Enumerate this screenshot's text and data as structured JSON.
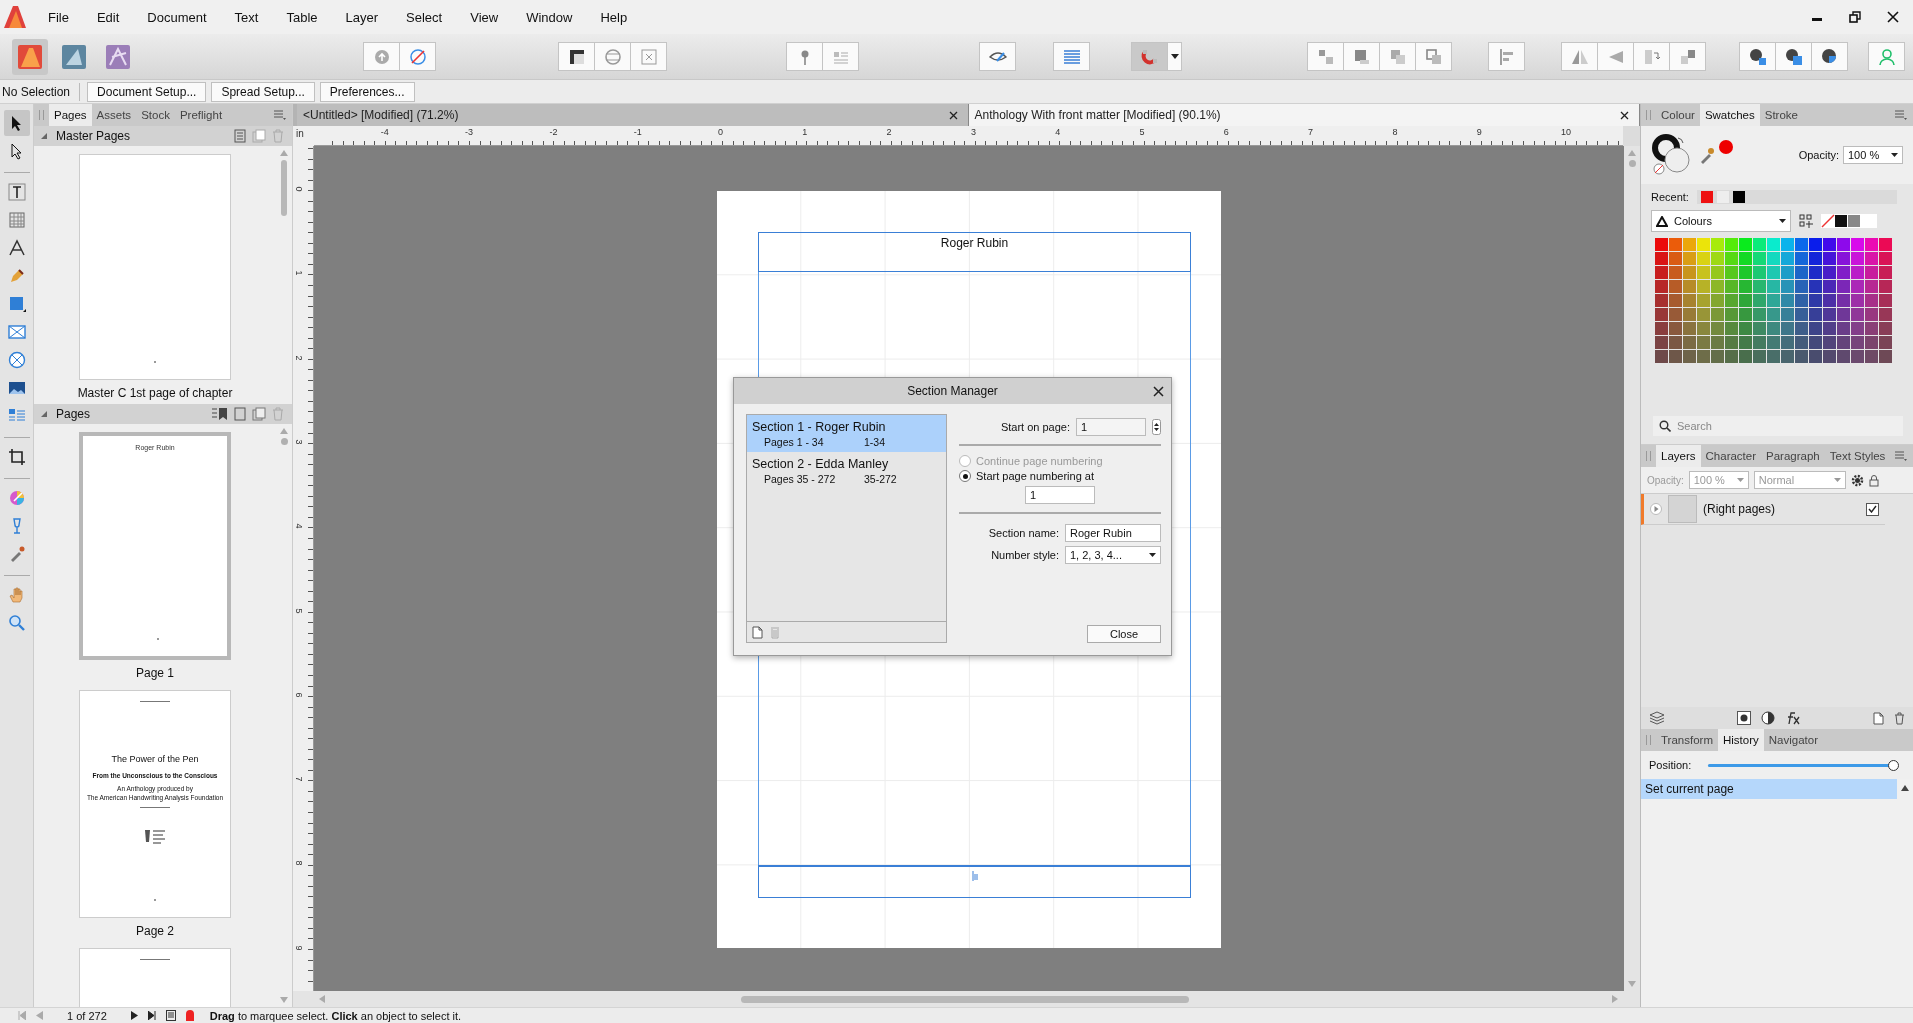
{
  "menu": [
    "File",
    "Edit",
    "Document",
    "Text",
    "Table",
    "Layer",
    "Select",
    "View",
    "Window",
    "Help"
  ],
  "personas": [
    {
      "selected": true
    },
    {
      "selected": false
    },
    {
      "selected": false
    }
  ],
  "snapping": {
    "on": true
  },
  "context_bar": {
    "status": "No Selection",
    "buttons": [
      "Document Setup...",
      "Spread Setup...",
      "Preferences..."
    ]
  },
  "tools": [
    {
      "kind": "move",
      "selected": true
    },
    {
      "kind": "node",
      "selected": false
    },
    {
      "kind": "text",
      "selected": false
    },
    {
      "kind": "table",
      "selected": false
    },
    {
      "kind": "artistic",
      "selected": false
    },
    {
      "kind": "pen",
      "selected": false
    },
    {
      "kind": "rectangle",
      "selected": false
    },
    {
      "kind": "frame",
      "selected": false
    },
    {
      "kind": "ellipse",
      "selected": false
    },
    {
      "kind": "image",
      "selected": false
    },
    {
      "kind": "wrap",
      "selected": false
    },
    {
      "kind": "crop",
      "selected": false
    },
    {
      "kind": "fill",
      "selected": false
    },
    {
      "kind": "transparency",
      "selected": false
    },
    {
      "kind": "picker",
      "selected": false
    },
    {
      "kind": "hand",
      "selected": false
    },
    {
      "kind": "zoom",
      "selected": false
    }
  ],
  "pages_panel": {
    "tabs": [
      {
        "label": "Pages",
        "selected": true
      },
      {
        "label": "Assets",
        "selected": false
      },
      {
        "label": "Stock",
        "selected": false
      },
      {
        "label": "Preflight",
        "selected": false
      }
    ],
    "master_pages": {
      "title": "Master Pages",
      "expanded": true,
      "items": [
        {
          "label": "Master C 1st page of chapter"
        }
      ]
    },
    "pages": {
      "title": "Pages",
      "expanded": true,
      "items": [
        {
          "kind": "header",
          "label": "Page 1",
          "selected": true,
          "header": "Roger Rubin"
        },
        {
          "kind": "title",
          "label": "Page 2",
          "selected": false,
          "title": "The Power of the Pen",
          "subtitle": "From the Unconscious to the Conscious",
          "credits": [
            "An Anthology produced by",
            "The American Handwriting Analysis Foundation"
          ]
        },
        {
          "kind": "partial",
          "selected": false
        }
      ]
    }
  },
  "documents": {
    "tabs": [
      {
        "label": "<Untitled> [Modified] (71.2%)",
        "selected": false
      },
      {
        "label": "Anthology With front matter [Modified] (90.1%)",
        "selected": true
      }
    ],
    "ruler_unit": "in",
    "h_ticks": [
      "-4",
      "-3",
      "-2",
      "-1",
      "0",
      "1",
      "2",
      "3",
      "4",
      "5",
      "6",
      "7",
      "8",
      "9",
      "10"
    ],
    "v_ticks": [
      "0",
      "1",
      "2",
      "3",
      "4",
      "5",
      "6",
      "7",
      "8",
      "9"
    ]
  },
  "page": {
    "header": "Roger Rubin"
  },
  "dialog": {
    "title": "Section Manager",
    "sections": [
      {
        "title": "Section 1 - Roger Rubin",
        "pages": "Pages 1 - 34",
        "range": "1-34",
        "selected": true
      },
      {
        "title": "Section 2 - Edda Manley",
        "pages": "Pages 35 - 272",
        "range": "35-272",
        "selected": false
      }
    ],
    "start_label": "Start on page:",
    "start_value": "1",
    "options": [
      {
        "label": "Continue page numbering",
        "selected": false,
        "disabled": true
      },
      {
        "label": "Start page numbering at",
        "selected": true,
        "disabled": false
      }
    ],
    "start_at": "1",
    "name_label": "Section name:",
    "name_value": "Roger Rubin",
    "style_label": "Number style:",
    "style_value": "1, 2, 3, 4...",
    "close": "Close"
  },
  "colour_panel": {
    "tabs": [
      {
        "label": "Colour",
        "selected": false
      },
      {
        "label": "Swatches",
        "selected": true
      },
      {
        "label": "Stroke",
        "selected": false
      }
    ],
    "opacity_label": "Opacity:",
    "opacity": "100 %",
    "recent_label": "Recent:",
    "recent": [
      {
        "color": "#ee1111"
      },
      {
        "color": "#eeeeee"
      },
      {
        "color": "#000000"
      }
    ],
    "palette": "Colours",
    "search_placeholder": "Search"
  },
  "layers_panel": {
    "tabs": [
      {
        "label": "Layers",
        "selected": true
      },
      {
        "label": "Character",
        "selected": false
      },
      {
        "label": "Paragraph",
        "selected": false
      },
      {
        "label": "Text Styles",
        "selected": false
      }
    ],
    "opacity_label": "Opacity:",
    "opacity": "100 %",
    "blend": "Normal",
    "disabled": true,
    "layers": [
      {
        "name": "(Right pages)",
        "visible": true,
        "expanded": false
      }
    ]
  },
  "history_panel": {
    "tabs": [
      {
        "label": "Transform",
        "selected": false
      },
      {
        "label": "History",
        "selected": true
      },
      {
        "label": "Navigator",
        "selected": false
      }
    ],
    "position_label": "Position:",
    "level": 1,
    "items": [
      {
        "label": "Set current page",
        "selected": true
      }
    ]
  },
  "status_bar": {
    "page": "1 of 272",
    "message": "**Drag** to marquee select. **Click** an object to select it."
  }
}
